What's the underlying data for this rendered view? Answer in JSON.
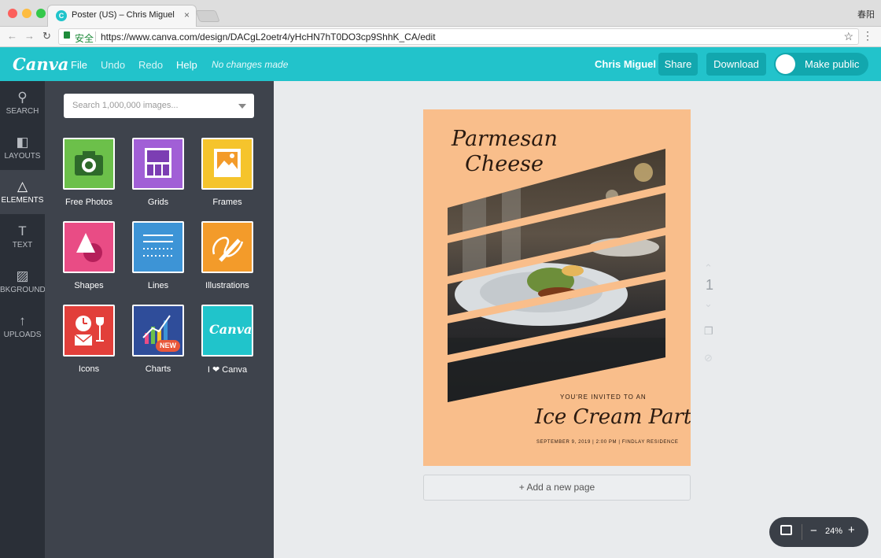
{
  "browser": {
    "tab_title": "Poster (US) – Chris Miguel",
    "tab_favicon": "C",
    "tab_close": "×",
    "user": "春阳",
    "secure_label": "安全",
    "url": "https://www.canva.com/design/DACgL2oetr4/yHcHN7hT0DO3cp9ShhK_CA/edit",
    "back": "←",
    "forward": "→",
    "reload": "↻",
    "star": "☆",
    "menu": "⋮"
  },
  "header": {
    "logo": "Canva",
    "menu": [
      "File",
      "Undo",
      "Redo",
      "Help"
    ],
    "status": "No changes made",
    "user_name": "Chris Miguel",
    "share_label": "Share",
    "download_label": "Download",
    "make_public_label": "Make public",
    "accent": "#22c3cb"
  },
  "sidebar": {
    "items": [
      {
        "label": "SEARCH",
        "icon": "⚲"
      },
      {
        "label": "LAYOUTS",
        "icon": "◧"
      },
      {
        "label": "ELEMENTS",
        "icon": "△"
      },
      {
        "label": "TEXT",
        "icon": "T"
      },
      {
        "label": "BKGROUND",
        "icon": "▨"
      },
      {
        "label": "UPLOADS",
        "icon": "↑"
      }
    ],
    "active": "ELEMENTS"
  },
  "panel": {
    "search_placeholder": "Search 1,000,000 images...",
    "tiles": [
      {
        "label": "Free Photos",
        "color": "#6cc04a"
      },
      {
        "label": "Grids",
        "color": "#a15fd6"
      },
      {
        "label": "Frames",
        "color": "#f5c42c"
      },
      {
        "label": "Shapes",
        "color": "#e94c85"
      },
      {
        "label": "Lines",
        "color": "#3d94d6"
      },
      {
        "label": "Illustrations",
        "color": "#f39b2a"
      },
      {
        "label": "Icons",
        "color": "#e23f3a"
      },
      {
        "label": "Charts",
        "color": "#2f4d9a",
        "badge": "NEW"
      },
      {
        "label": "I ❤ Canva",
        "color": "#20c4cb",
        "logo": "Canva"
      }
    ]
  },
  "poster": {
    "title": "Parmesan\n  Cheese",
    "invite": "YOU'RE INVITED TO AN",
    "event": "Ice Cream Party",
    "details": "SEPTEMBER 9, 2019 | 2:00 PM | FINDLAY RESIDENCE",
    "bg_color": "#f9be8b"
  },
  "canvas": {
    "add_page_label": "+ Add a new page",
    "page_number": "1",
    "zoom": "24%",
    "zoom_minus": "−",
    "zoom_plus": "+"
  }
}
